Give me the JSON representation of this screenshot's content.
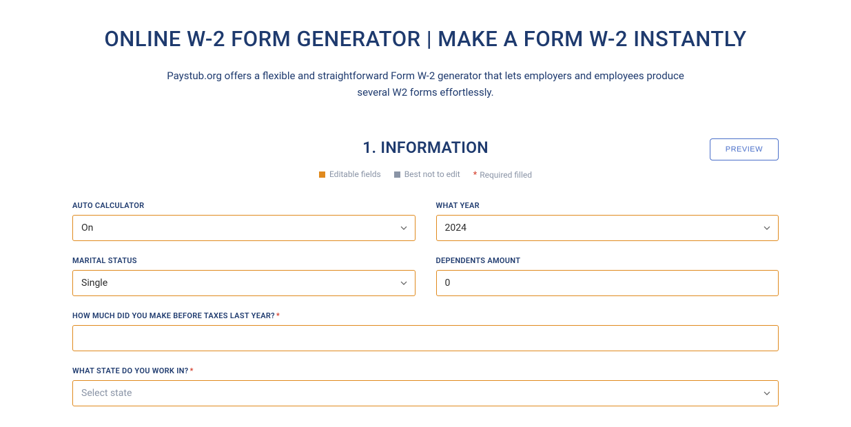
{
  "header": {
    "title": "ONLINE W-2 FORM GENERATOR | MAKE A FORM W-2 INSTANTLY",
    "subtitle": "Paystub.org offers a flexible and straightforward Form W-2 generator that lets employers and employees produce several W2 forms effortlessly."
  },
  "section": {
    "title": "1. INFORMATION",
    "preview_label": "PREVIEW"
  },
  "legend": {
    "editable": "Editable fields",
    "best_not": "Best not to edit",
    "required": "Required filled"
  },
  "fields": {
    "auto_calc": {
      "label": "AUTO CALCULATOR",
      "value": "On"
    },
    "year": {
      "label": "WHAT YEAR",
      "value": "2024"
    },
    "marital": {
      "label": "MARITAL STATUS",
      "value": "Single"
    },
    "dependents": {
      "label": "DEPENDENTS AMOUNT",
      "value": "0"
    },
    "income": {
      "label": "HOW MUCH DID YOU MAKE BEFORE TAXES LAST YEAR?",
      "value": ""
    },
    "state": {
      "label": "WHAT STATE DO YOU WORK IN?",
      "placeholder": "Select state"
    }
  }
}
